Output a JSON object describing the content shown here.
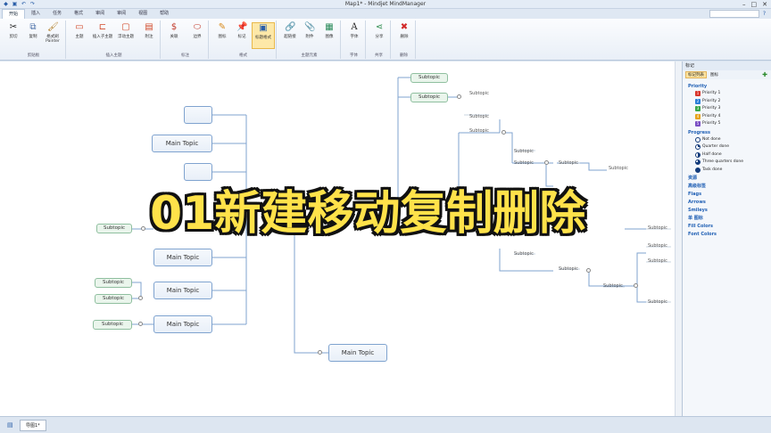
{
  "window": {
    "title": "Map1* - Mindjet MindManager"
  },
  "menu_tabs": [
    "开始",
    "插入",
    "任务",
    "格式",
    "审阅",
    "审阅",
    "视图",
    "帮助"
  ],
  "ribbon": {
    "groups": [
      {
        "label": "剪贴板",
        "buttons": [
          "剪切",
          "复制",
          "格式刷 Painter"
        ]
      },
      {
        "label": "插入主题",
        "buttons": [
          "主题",
          "插入子主题",
          "浮动主题",
          "附注"
        ]
      },
      {
        "label": "标注",
        "buttons": [
          "关联",
          "边界"
        ]
      },
      {
        "label": "格式",
        "buttons": [
          "图标",
          "标记",
          "标题格式"
        ]
      },
      {
        "label": "主题元素",
        "buttons": [
          "超链接",
          "附件",
          "图像"
        ]
      },
      {
        "label": "字体",
        "buttons": [
          "字体"
        ]
      },
      {
        "label": "共享",
        "buttons": [
          "分享"
        ]
      },
      {
        "label": "删除",
        "buttons": [
          "删除"
        ]
      }
    ]
  },
  "canvas": {
    "main_topics": [
      "Main Topic",
      "Main Topic",
      "Main Topic",
      "Main Topic",
      "Main Topic"
    ],
    "subtopic_label": "Subtopic"
  },
  "banner": "01新建移动复制删除",
  "panel": {
    "title": "标记",
    "tabs": [
      "标记列表",
      "图标"
    ],
    "priority_header": "Priority",
    "priorities": [
      {
        "label": "Priority 1",
        "num": "1",
        "color": "#d8342b"
      },
      {
        "label": "Priority 2",
        "num": "2",
        "color": "#2b7fd8"
      },
      {
        "label": "Priority 3",
        "num": "3",
        "color": "#3aa84a"
      },
      {
        "label": "Priority 4",
        "num": "4",
        "color": "#e6a21a"
      },
      {
        "label": "Priority 5",
        "num": "5",
        "color": "#7a4fc4"
      }
    ],
    "progress_header": "Progress",
    "progress": [
      "Not done",
      "Quarter done",
      "Half done",
      "Three quarters done",
      "Task done"
    ],
    "sections": [
      "资源",
      "高级标签",
      "Flags",
      "Arrows",
      "Smileys",
      "单 图标",
      "Fill Colors",
      "Font Colors"
    ]
  },
  "statusbar": {
    "doc_tab": "导图1*"
  }
}
